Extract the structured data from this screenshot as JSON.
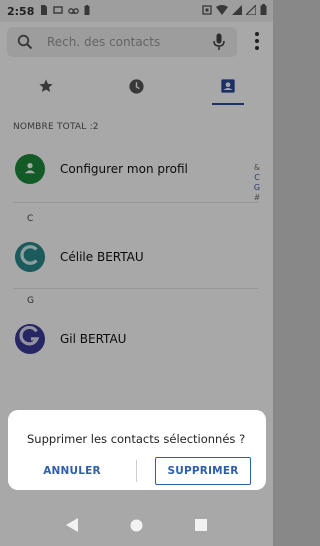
{
  "status_bar": {
    "time": "2:58",
    "left_icons": [
      "sim-card-icon",
      "nfc-icon",
      "voicemail-icon",
      "battery-saver-icon"
    ],
    "right_icons": [
      "vibrate-icon",
      "wifi-icon",
      "signal-icon",
      "signal-icon",
      "battery-icon"
    ]
  },
  "search": {
    "placeholder": "Rech. des contacts",
    "value": ""
  },
  "tabs": [
    {
      "name": "favorites",
      "icon": "star-icon",
      "active": false
    },
    {
      "name": "recents",
      "icon": "clock-icon",
      "active": false
    },
    {
      "name": "contacts",
      "icon": "contact-card-icon",
      "active": true
    }
  ],
  "total_label": "NOMBRE TOTAL :2",
  "profile": {
    "label": "Configurer mon profil",
    "avatar_color": "#1e8a3a"
  },
  "sections": [
    {
      "letter": "C",
      "contacts": [
        {
          "name": "Célile BERTAU",
          "avatar_color": "#2a8a8a"
        }
      ]
    },
    {
      "letter": "G",
      "contacts": [
        {
          "name": "Gil BERTAU",
          "avatar_color": "#3a3a9a"
        }
      ]
    }
  ],
  "alpha_index": [
    "&",
    "C",
    "G",
    "#"
  ],
  "dialog": {
    "message": "Supprimer les contacts sélectionnés ?",
    "cancel_label": "ANNULER",
    "confirm_label": "SUPPRIMER"
  },
  "colors": {
    "accent": "#2f5fa9",
    "scrim": "rgba(0,0,0,0.34)"
  }
}
